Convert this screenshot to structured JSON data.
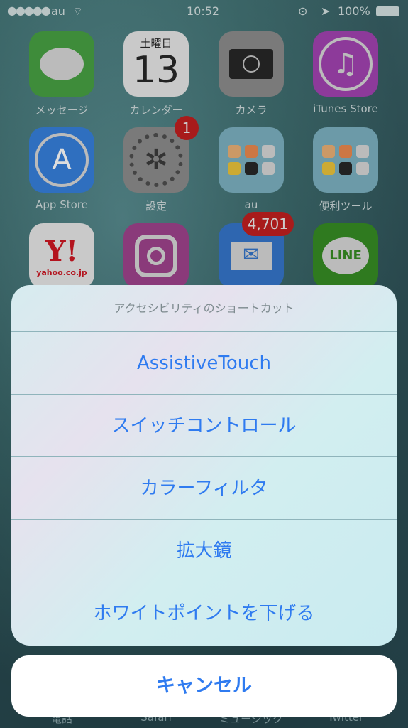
{
  "status": {
    "carrier": "au",
    "time": "10:52",
    "battery": "100%",
    "signal_dots": 5
  },
  "apps": [
    {
      "label": "メッセージ",
      "icon": "messages-icon",
      "color": "#3e8c3a"
    },
    {
      "label": "カレンダー",
      "icon": "calendar-icon",
      "weekday": "土曜日",
      "day": "13",
      "color": "#c9c9c9"
    },
    {
      "label": "カメラ",
      "icon": "camera-icon",
      "color": "#7a7a7a"
    },
    {
      "label": "iTunes Store",
      "icon": "itunes-icon",
      "color": "#8d3a9a"
    },
    {
      "label": "App Store",
      "icon": "app-store-icon",
      "color": "#2f6fbf"
    },
    {
      "label": "設定",
      "icon": "settings-icon",
      "badge": "1",
      "color": "#7a7a7a"
    },
    {
      "label": "au",
      "icon": "folder-icon",
      "color": "#6c9aa8"
    },
    {
      "label": "便利ツール",
      "icon": "folder-icon",
      "color": "#6c9aa8"
    },
    {
      "label": "",
      "icon": "yahoo-icon",
      "logo": "Y!",
      "sub": "yahoo.co.jp",
      "color": "#c9c9c9"
    },
    {
      "label": "",
      "icon": "instagram-icon",
      "color": "#8a3a7a"
    },
    {
      "label": "",
      "icon": "mail-icon",
      "badge": "4,701",
      "color": "#2e66b0"
    },
    {
      "label": "",
      "icon": "line-icon",
      "logo": "LINE",
      "color": "#2f7a1f"
    }
  ],
  "dock": [
    "電話",
    "Safari",
    "ミュージック",
    "Twitter"
  ],
  "sheet": {
    "title": "アクセシビリティのショートカット",
    "options": [
      "AssistiveTouch",
      "スイッチコントロール",
      "カラーフィルタ",
      "拡大鏡",
      "ホワイトポイントを下げる"
    ],
    "cancel": "キャンセル",
    "accent": "#2f7bf0"
  }
}
